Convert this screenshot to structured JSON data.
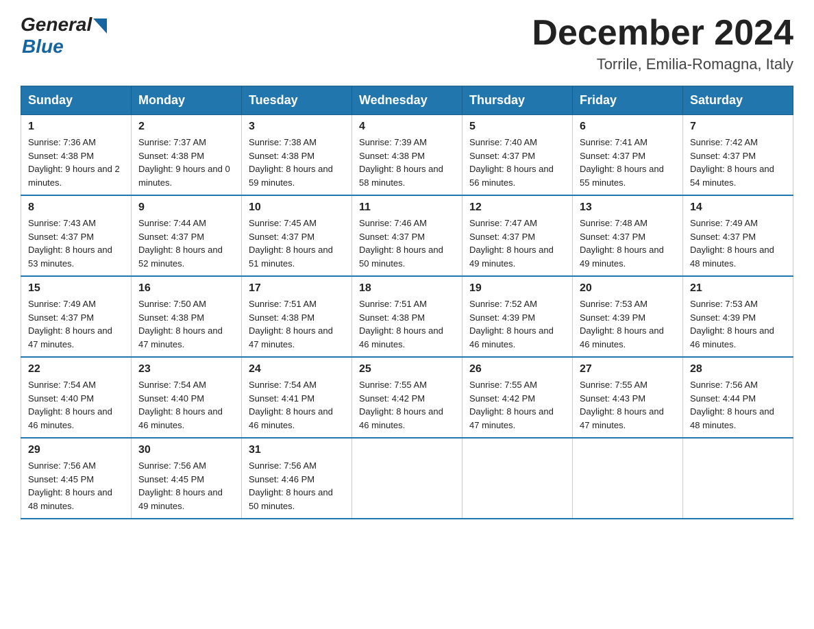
{
  "header": {
    "logo_text_general": "General",
    "logo_text_blue": "Blue",
    "month_title": "December 2024",
    "location": "Torrile, Emilia-Romagna, Italy"
  },
  "days_of_week": [
    "Sunday",
    "Monday",
    "Tuesday",
    "Wednesday",
    "Thursday",
    "Friday",
    "Saturday"
  ],
  "weeks": [
    [
      {
        "day": "1",
        "sunrise": "7:36 AM",
        "sunset": "4:38 PM",
        "daylight": "9 hours and 2 minutes."
      },
      {
        "day": "2",
        "sunrise": "7:37 AM",
        "sunset": "4:38 PM",
        "daylight": "9 hours and 0 minutes."
      },
      {
        "day": "3",
        "sunrise": "7:38 AM",
        "sunset": "4:38 PM",
        "daylight": "8 hours and 59 minutes."
      },
      {
        "day": "4",
        "sunrise": "7:39 AM",
        "sunset": "4:38 PM",
        "daylight": "8 hours and 58 minutes."
      },
      {
        "day": "5",
        "sunrise": "7:40 AM",
        "sunset": "4:37 PM",
        "daylight": "8 hours and 56 minutes."
      },
      {
        "day": "6",
        "sunrise": "7:41 AM",
        "sunset": "4:37 PM",
        "daylight": "8 hours and 55 minutes."
      },
      {
        "day": "7",
        "sunrise": "7:42 AM",
        "sunset": "4:37 PM",
        "daylight": "8 hours and 54 minutes."
      }
    ],
    [
      {
        "day": "8",
        "sunrise": "7:43 AM",
        "sunset": "4:37 PM",
        "daylight": "8 hours and 53 minutes."
      },
      {
        "day": "9",
        "sunrise": "7:44 AM",
        "sunset": "4:37 PM",
        "daylight": "8 hours and 52 minutes."
      },
      {
        "day": "10",
        "sunrise": "7:45 AM",
        "sunset": "4:37 PM",
        "daylight": "8 hours and 51 minutes."
      },
      {
        "day": "11",
        "sunrise": "7:46 AM",
        "sunset": "4:37 PM",
        "daylight": "8 hours and 50 minutes."
      },
      {
        "day": "12",
        "sunrise": "7:47 AM",
        "sunset": "4:37 PM",
        "daylight": "8 hours and 49 minutes."
      },
      {
        "day": "13",
        "sunrise": "7:48 AM",
        "sunset": "4:37 PM",
        "daylight": "8 hours and 49 minutes."
      },
      {
        "day": "14",
        "sunrise": "7:49 AM",
        "sunset": "4:37 PM",
        "daylight": "8 hours and 48 minutes."
      }
    ],
    [
      {
        "day": "15",
        "sunrise": "7:49 AM",
        "sunset": "4:37 PM",
        "daylight": "8 hours and 47 minutes."
      },
      {
        "day": "16",
        "sunrise": "7:50 AM",
        "sunset": "4:38 PM",
        "daylight": "8 hours and 47 minutes."
      },
      {
        "day": "17",
        "sunrise": "7:51 AM",
        "sunset": "4:38 PM",
        "daylight": "8 hours and 47 minutes."
      },
      {
        "day": "18",
        "sunrise": "7:51 AM",
        "sunset": "4:38 PM",
        "daylight": "8 hours and 46 minutes."
      },
      {
        "day": "19",
        "sunrise": "7:52 AM",
        "sunset": "4:39 PM",
        "daylight": "8 hours and 46 minutes."
      },
      {
        "day": "20",
        "sunrise": "7:53 AM",
        "sunset": "4:39 PM",
        "daylight": "8 hours and 46 minutes."
      },
      {
        "day": "21",
        "sunrise": "7:53 AM",
        "sunset": "4:39 PM",
        "daylight": "8 hours and 46 minutes."
      }
    ],
    [
      {
        "day": "22",
        "sunrise": "7:54 AM",
        "sunset": "4:40 PM",
        "daylight": "8 hours and 46 minutes."
      },
      {
        "day": "23",
        "sunrise": "7:54 AM",
        "sunset": "4:40 PM",
        "daylight": "8 hours and 46 minutes."
      },
      {
        "day": "24",
        "sunrise": "7:54 AM",
        "sunset": "4:41 PM",
        "daylight": "8 hours and 46 minutes."
      },
      {
        "day": "25",
        "sunrise": "7:55 AM",
        "sunset": "4:42 PM",
        "daylight": "8 hours and 46 minutes."
      },
      {
        "day": "26",
        "sunrise": "7:55 AM",
        "sunset": "4:42 PM",
        "daylight": "8 hours and 47 minutes."
      },
      {
        "day": "27",
        "sunrise": "7:55 AM",
        "sunset": "4:43 PM",
        "daylight": "8 hours and 47 minutes."
      },
      {
        "day": "28",
        "sunrise": "7:56 AM",
        "sunset": "4:44 PM",
        "daylight": "8 hours and 48 minutes."
      }
    ],
    [
      {
        "day": "29",
        "sunrise": "7:56 AM",
        "sunset": "4:45 PM",
        "daylight": "8 hours and 48 minutes."
      },
      {
        "day": "30",
        "sunrise": "7:56 AM",
        "sunset": "4:45 PM",
        "daylight": "8 hours and 49 minutes."
      },
      {
        "day": "31",
        "sunrise": "7:56 AM",
        "sunset": "4:46 PM",
        "daylight": "8 hours and 50 minutes."
      },
      null,
      null,
      null,
      null
    ]
  ]
}
